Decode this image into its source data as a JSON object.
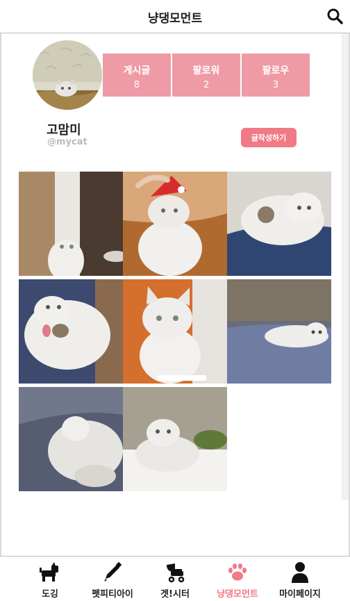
{
  "header": {
    "title": "냥댕모먼트",
    "search_icon": "search-icon"
  },
  "profile": {
    "name": "고맘미",
    "handle": "@mycat",
    "write_button": "글작성하기",
    "stats": [
      {
        "label": "게시글",
        "value": "8"
      },
      {
        "label": "팔로워",
        "value": "2"
      },
      {
        "label": "팔로우",
        "value": "3"
      }
    ]
  },
  "posts": [
    {
      "icon": "cat-photo"
    },
    {
      "icon": "cat-photo"
    },
    {
      "icon": "cat-photo"
    },
    {
      "icon": "cat-photo"
    },
    {
      "icon": "cat-photo"
    },
    {
      "icon": "cat-photo"
    },
    {
      "icon": "cat-photo"
    },
    {
      "icon": "cat-photo"
    }
  ],
  "nav": {
    "items": [
      {
        "label": "도깅",
        "icon": "dog-icon"
      },
      {
        "label": "펫피티아이",
        "icon": "pencil-icon"
      },
      {
        "label": "겟!시터",
        "icon": "stroller-icon"
      },
      {
        "label": "냥댕모먼트",
        "icon": "paw-icon",
        "active": true
      },
      {
        "label": "마이페이지",
        "icon": "user-icon"
      }
    ]
  },
  "colors": {
    "accent": "#f07a85",
    "stat_bg": "#ee9ba6"
  }
}
